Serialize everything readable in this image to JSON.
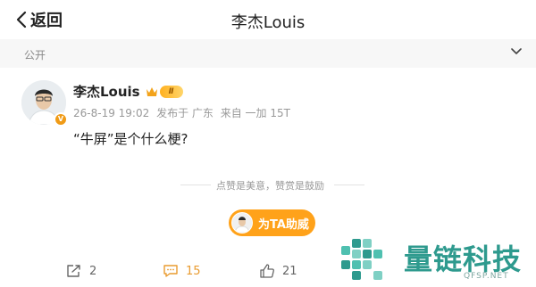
{
  "header": {
    "back_label": "返回",
    "title": "李杰Louis"
  },
  "visibility": {
    "label": "公开"
  },
  "post": {
    "author": "李杰Louis",
    "vip_level": "Ⅱ",
    "date": "26-8-19 19:02",
    "location": "发布于 广东",
    "source": "来自 一加 15T",
    "text": "“牛屏”是个什么梗?"
  },
  "tip": {
    "text": "点赞是美意，赞赏是鼓励"
  },
  "boost": {
    "label": "为TA助威"
  },
  "actions": {
    "reposts": "2",
    "comments": "15",
    "likes": "21"
  },
  "watermark": {
    "title": "量链科技",
    "url": "QFSP.NET"
  },
  "colors": {
    "accent": "#ffa21a",
    "comment_active": "#e99b2f",
    "watermark": "#2e9a8e"
  }
}
